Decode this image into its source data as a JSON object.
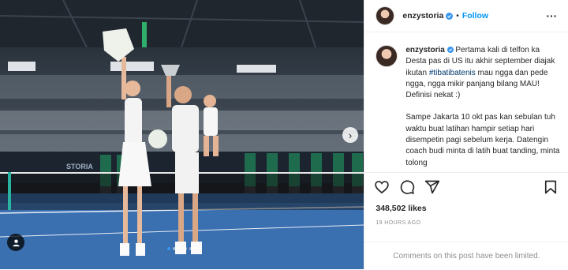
{
  "post": {
    "username": "enzystoria",
    "follow_label": "Follow",
    "separator": "•",
    "more_label": "···",
    "caption_p1_pre": "Pertama kali di telfon ka Desta pas di US itu akhir september diajak ikutan ",
    "caption_hashtag": "#tibatibatenis",
    "caption_p1_post": " mau ngga dan pede ngga, ngga mikir panjang bilang MAU! Definisi nekat :)",
    "caption_p2": "Sampe Jakarta 10 okt pas kan sebulan tuh waktu buat latihan hampir setiap hari disempetin pagi sebelum kerja. Datengin coach budi minta di latih buat tanding, minta tolong",
    "likes": "348,502 likes",
    "timestamp": "19 HOURS AGO",
    "comments_status": "Comments on this post have been limited.",
    "carousel": {
      "total": 6,
      "active_index": 0
    }
  },
  "colors": {
    "follow_blue": "#0095f6",
    "verified_blue": "#3897f0",
    "muted": "#8e8e8e",
    "court_blue": "#3a6fb0"
  },
  "icons": [
    "verified-badge-icon",
    "more-options-icon",
    "heart-icon",
    "comment-icon",
    "share-icon",
    "bookmark-icon",
    "user-tag-icon",
    "chevron-right-icon"
  ]
}
